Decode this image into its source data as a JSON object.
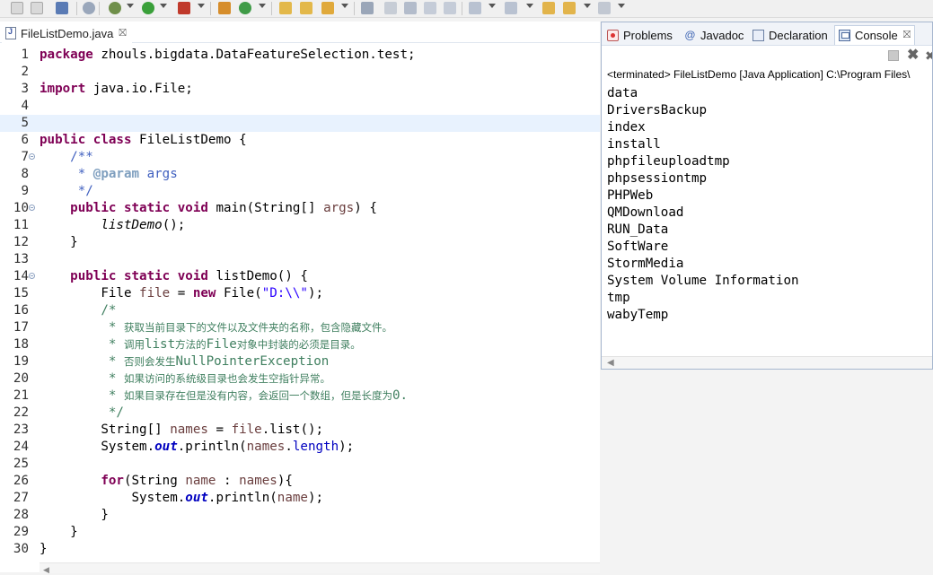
{
  "toolbar": {
    "icons": [
      "save-icon",
      "save-all-icon",
      "print-icon",
      "debug-icon",
      "settings-icon",
      "run-icon",
      "coverage-icon",
      "new-class-icon",
      "refresh-icon",
      "open-folder-icon",
      "open-type-icon",
      "search-icon",
      "pin-icon",
      "link-icon",
      "task-icon",
      "outline-icon",
      "format-icon",
      "annotation-icon",
      "next-annotation-icon",
      "back-icon",
      "forward-icon",
      "history-icon"
    ]
  },
  "editor": {
    "tab": {
      "label": "FileListDemo.java",
      "close": "⛝"
    },
    "highlight_line": 5,
    "lines": [
      {
        "n": "1"
      },
      {
        "n": "2"
      },
      {
        "n": "3"
      },
      {
        "n": "4"
      },
      {
        "n": "5"
      },
      {
        "n": "6"
      },
      {
        "n": "7"
      },
      {
        "n": "8"
      },
      {
        "n": "9"
      },
      {
        "n": "10"
      },
      {
        "n": "11"
      },
      {
        "n": "12"
      },
      {
        "n": "13"
      },
      {
        "n": "14"
      },
      {
        "n": "15"
      },
      {
        "n": "16"
      },
      {
        "n": "17"
      },
      {
        "n": "18"
      },
      {
        "n": "19"
      },
      {
        "n": "20"
      },
      {
        "n": "21"
      },
      {
        "n": "22"
      },
      {
        "n": "23"
      },
      {
        "n": "24"
      },
      {
        "n": "25"
      },
      {
        "n": "26"
      },
      {
        "n": "27"
      },
      {
        "n": "28"
      },
      {
        "n": "29"
      },
      {
        "n": "30"
      }
    ],
    "code": {
      "l1": {
        "kw": "package",
        "rest": " zhouls.bigdata.DataFeatureSelection.test;"
      },
      "l3": {
        "kw": "import",
        "rest": " java.io.File;"
      },
      "l6": {
        "kw1": "public",
        "kw2": "class",
        "rest": " FileListDemo {"
      },
      "l7": {
        "text": "    /**"
      },
      "l8": {
        "pre": "     * ",
        "tag": "@param",
        "rest": " args"
      },
      "l9": {
        "text": "     */"
      },
      "l10": {
        "kw1": "public",
        "kw2": "static",
        "kw3": "void",
        "a": " main(String[] ",
        "var": "args",
        "b": ") {"
      },
      "l11": {
        "pre": "        ",
        "it": "listDemo",
        "rest": "();"
      },
      "l12": {
        "text": "    }"
      },
      "l14": {
        "kw1": "public",
        "kw2": "static",
        "kw3": "void",
        "rest": " listDemo() {"
      },
      "l15": {
        "a": "        File ",
        "var": "file",
        "b": " = ",
        "kw": "new",
        "c": " File(",
        "str": "\"D:\\\\\"",
        "d": ");"
      },
      "l16": {
        "text": "        /*"
      },
      "l17": {
        "pre": "         * ",
        "zh": "获取当前目录下的文件以及文件夹的名称，包含隐藏文件。"
      },
      "l18": {
        "pre": "         * ",
        "zh1": "调用",
        "a": "list",
        "zh2": "方法的",
        "b": "File",
        "zh3": "对象中封装的必须是目录。"
      },
      "l19": {
        "pre": "         * ",
        "zh": "否则会发生",
        "a": "NullPointerException"
      },
      "l20": {
        "pre": "         * ",
        "zh": "如果访问的系统级目录也会发生空指针异常。"
      },
      "l21": {
        "pre": "         * ",
        "zh": "如果目录存在但是没有内容，会返回一个数组，但是长度为",
        "a": "0."
      },
      "l22": {
        "text": "         */"
      },
      "l23": {
        "a": "        String[] ",
        "var": "names",
        "b": " = ",
        "var2": "file",
        "c": ".list();"
      },
      "l24": {
        "a": "        System.",
        "sf": "out",
        "b": ".println(",
        "var": "names",
        "c": ".",
        "fld": "length",
        "d": ");"
      },
      "l26": {
        "pre": "        ",
        "kw": "for",
        "a": "(String ",
        "var": "name",
        "b": " : ",
        "var2": "names",
        "c": "){"
      },
      "l27": {
        "a": "            System.",
        "sf": "out",
        "b": ".println(",
        "var": "name",
        "c": ");"
      },
      "l28": {
        "text": "        }"
      },
      "l29": {
        "text": "    }"
      },
      "l30": {
        "text": "}"
      }
    }
  },
  "console": {
    "tabs": [
      {
        "label": "Problems",
        "icon": "problems-icon"
      },
      {
        "label": "Javadoc",
        "icon": "javadoc-icon",
        "glyph": "@"
      },
      {
        "label": "Declaration",
        "icon": "declaration-icon"
      },
      {
        "label": "Console",
        "icon": "console-icon",
        "close": "⛝"
      }
    ],
    "status": "<terminated> FileListDemo [Java Application] C:\\Program Files\\",
    "output": [
      "data",
      "DriversBackup",
      "index",
      "install",
      "phpfileuploadtmp",
      "phpsessiontmp",
      "PHPWeb",
      "QMDownload",
      "RUN_Data",
      "SoftWare",
      "StormMedia",
      "System Volume Information",
      "tmp",
      "wabyTemp"
    ],
    "actions": {
      "remove": "✖",
      "remove_all": "✖"
    }
  },
  "colors": {
    "keyword": "#7f0055",
    "comment": "#3f7f5f",
    "javadoc": "#3f5fbf",
    "string": "#2a00ff",
    "highlight": "#e8f2fe"
  }
}
